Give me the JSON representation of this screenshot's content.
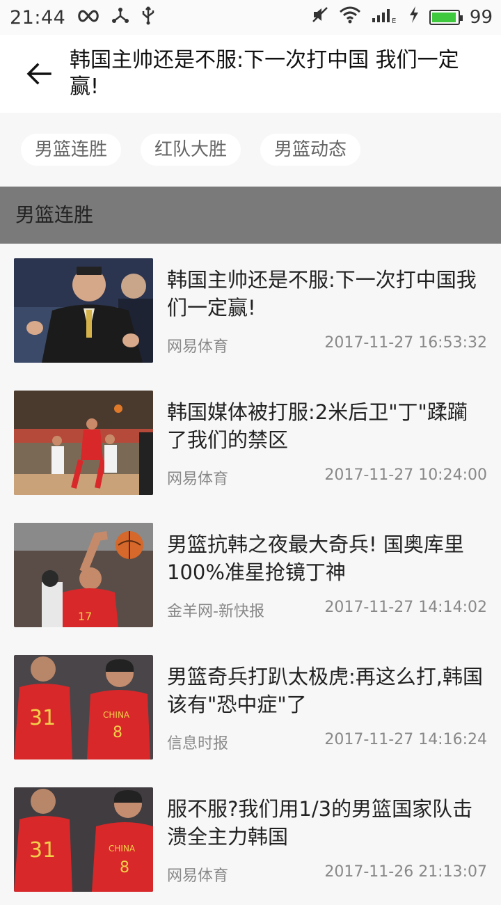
{
  "status_bar": {
    "time": "21:44",
    "battery": "99"
  },
  "header": {
    "title": "韩国主帅还是不服:下一次打中国 我们一定赢!"
  },
  "tags": [
    "男篮连胜",
    "红队大胜",
    "男篮动态"
  ],
  "section": {
    "title": "男篮连胜"
  },
  "news": [
    {
      "title": "韩国主帅还是不服:下一次打中国我们一定赢!",
      "source": "网易体育",
      "time": "2017-11-27 16:53:32"
    },
    {
      "title": "韩国媒体被打服:2米后卫\"丁\"蹂躏了我们的禁区",
      "source": "网易体育",
      "time": "2017-11-27 10:24:00"
    },
    {
      "title": "男篮抗韩之夜最大奇兵! 国奥库里100%准星抢镜丁神",
      "source": "金羊网-新快报",
      "time": "2017-11-27 14:14:02"
    },
    {
      "title": "男篮奇兵打趴太极虎:再这么打,韩国该有\"恐中症\"了",
      "source": "信息时报",
      "time": "2017-11-27 14:16:24"
    },
    {
      "title": "服不服?我们用1/3的男篮国家队击溃全主力韩国",
      "source": "网易体育",
      "time": "2017-11-26 21:13:07"
    }
  ]
}
